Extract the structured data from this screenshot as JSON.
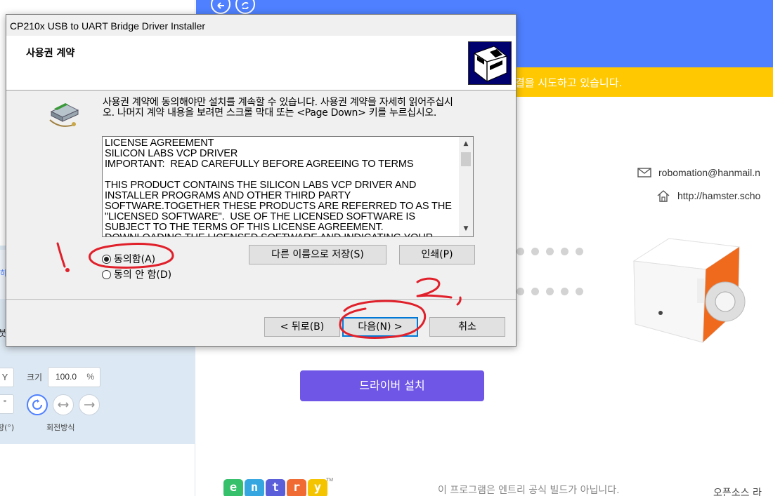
{
  "background": {
    "left_panel": {
      "side_label_1": "하",
      "side_label_2": "붓",
      "y_field": "Y",
      "deg_field": "°",
      "size_label": "크기",
      "size_value": "100.0",
      "size_unit": "%",
      "direction_caption": "향(°)",
      "rotation_caption": "회전방식"
    },
    "connect_panel": {
      "status_message": "결을 시도하고 있습니다.",
      "email": "robomation@hanmail.n",
      "homepage": "http://hamster.scho",
      "driver_button": "드라이버 설치",
      "not_official_notice": "이 프로그램은 엔트리 공식 빌드가 아닙니다.",
      "opensource_label": "오픈소스 라"
    },
    "entry_logo": {
      "letters": [
        "e",
        "n",
        "t",
        "r",
        "y"
      ],
      "colors": [
        "#36c06b",
        "#36a6e0",
        "#5a5ed8",
        "#ef6b33",
        "#f5c400"
      ],
      "tm": "TM"
    },
    "colors": {
      "top_bar": "#4f80ff",
      "status_bar": "#ffc800",
      "driver_button": "#6f56e6"
    }
  },
  "dialog": {
    "title": "CP210x USB to UART Bridge Driver Installer",
    "heading": "사용권 계약",
    "instruction": "사용권 계약에 동의해야만 설치를 계속할 수 있습니다. 사용권 계약을 자세히 읽어주십시오. 나머지 계약 내용을 보려면 스크롤 막대 또는 <Page Down> 키를 누르십시오.",
    "license_text": "LICENSE AGREEMENT\nSILICON LABS VCP DRIVER\nIMPORTANT:  READ CAREFULLY BEFORE AGREEING TO TERMS\n\nTHIS PRODUCT CONTAINS THE SILICON LABS VCP DRIVER AND INSTALLER PROGRAMS AND OTHER THIRD PARTY SOFTWARE.TOGETHER THESE PRODUCTS ARE REFERRED TO AS THE \"LICENSED SOFTWARE\".  USE OF THE LICENSED SOFTWARE IS SUBJECT TO THE TERMS OF THIS LICENSE AGREEMENT.\nDOWNLOADING THE LICENSED SOFTWARE AND INDICATING YOUR",
    "radio_accept": "동의함(A)",
    "radio_decline": "동의 안 함(D)",
    "accept_selected": true,
    "save_as_button": "다른 이름으로 저장(S)",
    "print_button": "인쇄(P)",
    "back_button": "< 뒤로(B)",
    "next_button": "다음(N) >",
    "cancel_button": "취소"
  },
  "annotations": {
    "step_1": "1.",
    "step_2": "2.",
    "color": "#e0202a"
  }
}
